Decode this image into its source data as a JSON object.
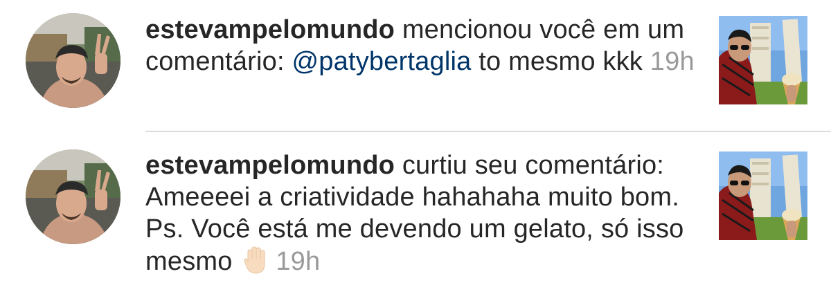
{
  "notifications": [
    {
      "username": "estevampelomundo",
      "action_text": " mencionou você em um comentário: ",
      "mention": "@patybertaglia",
      "comment": " to mesmo kkk",
      "time": "19h",
      "avatar_icon": "user-avatar-photo",
      "thumbnail_icon": "post-thumbnail-photo"
    },
    {
      "username": "estevampelomundo",
      "action_text": " curtiu seu comentário: Ameeeei a criatividade hahahaha muito bom. Ps. Você está me devendo um gelato, só isso mesmo",
      "emoji": "raised-hand-emoji",
      "time": "19h",
      "avatar_icon": "user-avatar-photo",
      "thumbnail_icon": "post-thumbnail-photo"
    }
  ],
  "colors": {
    "text": "#262626",
    "mention": "#003569",
    "time": "#999999",
    "divider": "#dbdbdb"
  }
}
